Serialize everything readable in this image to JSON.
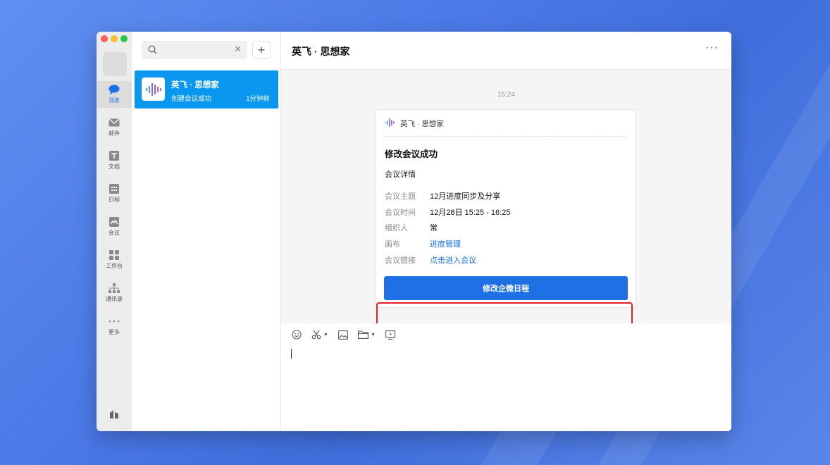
{
  "colors": {
    "accent": "#1f6fe5",
    "selected_conversation": "#0a97f0",
    "highlight": "#e21f26",
    "traffic_close": "#ff5f57",
    "traffic_min": "#febc2e",
    "traffic_max": "#28c840"
  },
  "rail": {
    "items": [
      {
        "label": "消息",
        "icon": "chat-bubble-icon"
      },
      {
        "label": "邮件",
        "icon": "mail-icon"
      },
      {
        "label": "文档",
        "icon": "document-icon"
      },
      {
        "label": "日程",
        "icon": "calendar-icon"
      },
      {
        "label": "会议",
        "icon": "meeting-icon"
      },
      {
        "label": "工作台",
        "icon": "grid-icon"
      },
      {
        "label": "通讯录",
        "icon": "org-chart-icon"
      },
      {
        "label": "更多",
        "icon": "more-dots-icon"
      }
    ],
    "active_index": 0
  },
  "list": {
    "search": {
      "placeholder": "",
      "value": "",
      "icon": "search-icon",
      "clear_icon": "close-icon"
    },
    "add_icon": "plus-icon",
    "conversations": [
      {
        "name": "英飞 · 思想家",
        "last_message": "创建会议成功",
        "time": "1分钟前",
        "icon": "audio-wave-icon",
        "selected": true
      }
    ]
  },
  "chat": {
    "title": "英飞 · 思想家",
    "more_label": "···",
    "timestamp": "15:24",
    "card": {
      "bot_name": "英飞 · 思想家",
      "title": "修改会议成功",
      "subtitle": "会议详情",
      "details": [
        {
          "key": "会议主题",
          "value": "12月进度同步及分享",
          "link": false
        },
        {
          "key": "会议时间",
          "value": "12月28日 15:25 - 16:25",
          "link": false
        },
        {
          "key": "组织人",
          "value": "常",
          "link": false
        },
        {
          "key": "画布",
          "value": "进度管理",
          "link": true
        },
        {
          "key": "会议链接",
          "value": "点击进入会议",
          "link": true
        }
      ],
      "button_label": "修改企微日程"
    },
    "composer": {
      "tools": [
        "emoji-icon",
        "scissors-icon",
        "image-icon",
        "folder-icon",
        "screen-record-icon"
      ],
      "value": ""
    }
  }
}
